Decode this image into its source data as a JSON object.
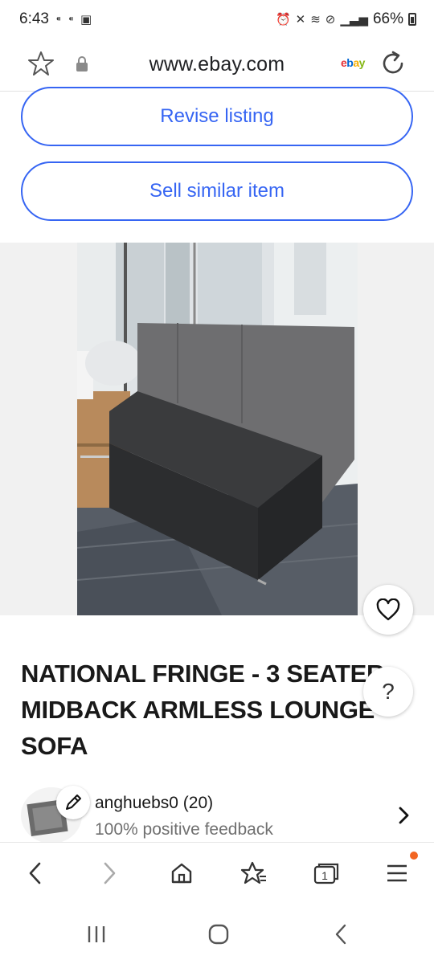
{
  "status_bar": {
    "time": "6:43",
    "battery": "66%"
  },
  "url_bar": {
    "url": "www.ebay.com",
    "site_logo": "ebay"
  },
  "actions": {
    "revise_label": "Revise listing",
    "sell_similar_label": "Sell similar item"
  },
  "item": {
    "title": "NATIONAL FRINGE - 3 SEATER - MIDBACK ARMLESS LOUNGE SOFA"
  },
  "help": {
    "label": "?"
  },
  "seller": {
    "name": "anghuebs0 (20)",
    "feedback": "100% positive feedback"
  },
  "browser_nav": {
    "tab_count": "1"
  },
  "icons": {
    "favorite": "heart-icon",
    "edit": "pencil-icon",
    "bookmark": "star-icon",
    "lock": "lock-icon",
    "reload": "reload-icon",
    "back": "back-icon",
    "forward": "forward-icon",
    "home": "home-icon",
    "bookmarks": "bookmarks-icon",
    "tabs": "tabs-icon",
    "menu": "menu-icon"
  },
  "colors": {
    "accent": "#3665f3",
    "notification": "#f26522"
  }
}
